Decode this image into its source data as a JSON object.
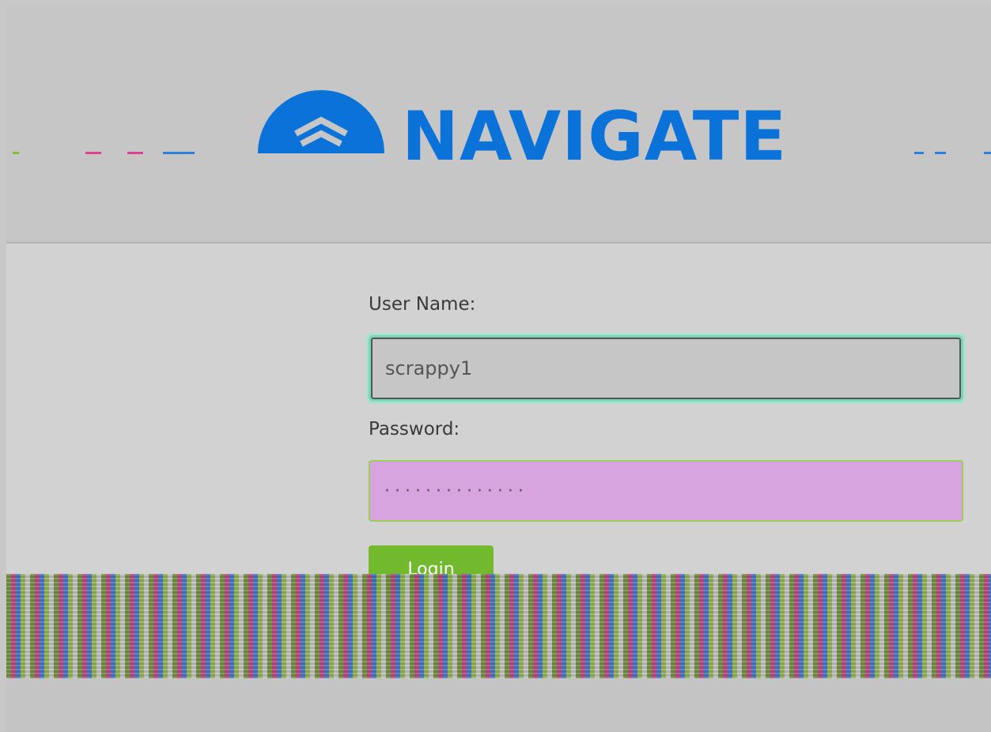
{
  "brand": {
    "wordmark": "NAVIGATE",
    "accent_color": "#0a72d9"
  },
  "login_form": {
    "username_label": "User Name:",
    "username_value": "scrappy1",
    "password_label": "Password:",
    "password_masked": "··············",
    "login_button_label": "Login",
    "button_color": "#72b92d"
  }
}
